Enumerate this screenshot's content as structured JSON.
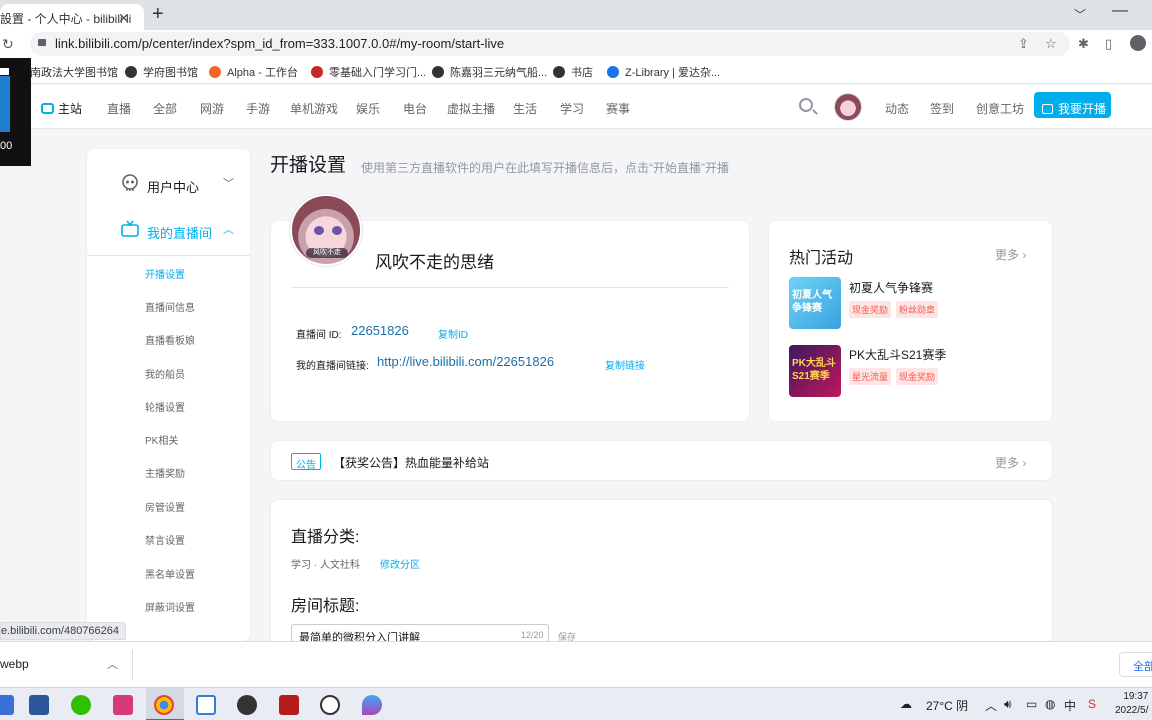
{
  "browser": {
    "tab_title": "設置 - 个人中心 - bilibili li",
    "tab_close": "✕",
    "new_tab": "+",
    "url": "link.bilibili.com/p/center/index?spm_id_from=333.1007.0.0#/my-room/start-live",
    "bookmarks": [
      {
        "label": "南政法大学图书馆",
        "color": "#1f5fa8"
      },
      {
        "label": "学府图书馆",
        "color": "#333333"
      },
      {
        "label": "Alpha - 工作台",
        "color": "#f26522"
      },
      {
        "label": "零基础入门学习门...",
        "color": "#c62828"
      },
      {
        "label": "陈嘉羽三元纳气船...",
        "color": "#333333"
      },
      {
        "label": "书店",
        "color": "#333333"
      },
      {
        "label": "Z-Library | 爱达杂...",
        "color": "#1a73e8"
      }
    ]
  },
  "overlay": {
    "text": "00"
  },
  "site_nav": {
    "items": [
      "主站",
      "直播",
      "全部",
      "网游",
      "手游",
      "单机游戏",
      "娱乐",
      "电台",
      "虚拟主播",
      "生活",
      "学习",
      "赛事"
    ],
    "right_links": [
      "动态",
      "签到",
      "创意工坊"
    ],
    "start_live": "我要开播"
  },
  "sidebar": {
    "groups": [
      {
        "label": "用户中心",
        "chevron": "﹀"
      },
      {
        "label": "我的直播间",
        "chevron": "︿"
      }
    ],
    "items": [
      "开播设置",
      "直播间信息",
      "直播看板娘",
      "我的船员",
      "轮播设置",
      "PK相关",
      "主播奖励",
      "房管设置",
      "禁言设置",
      "黑名单设置",
      "屏蔽词设置"
    ]
  },
  "page": {
    "title": "开播设置",
    "subtitle": "使用第三方直播软件的用户在此填写开播信息后，点击“开始直播”开播"
  },
  "profile": {
    "avatar_badge": "风吹不走",
    "username": "风吹不走的思绪",
    "room_id_label": "直播间 ID:",
    "room_id": "22651826",
    "copy_id": "复制ID",
    "link_label": "我的直播间链接:",
    "link": "http://live.bilibili.com/22651826",
    "copy_link": "复制链接"
  },
  "hot": {
    "title": "热门活动",
    "more": "更多 ›",
    "activities": [
      {
        "name": "初夏人气争锋赛",
        "thumb_text": "初夏人气争锋赛",
        "tags": [
          "现金奖励",
          "粉丝勋章"
        ]
      },
      {
        "name": "PK大乱斗S21赛季",
        "thumb_text": "PK大乱斗S21赛季",
        "tags": [
          "星光流量",
          "现金奖励"
        ]
      }
    ]
  },
  "notice": {
    "tag": "公告",
    "text": "【获奖公告】热血能量补给站",
    "more": "更多 ›"
  },
  "settings": {
    "category_title": "直播分类:",
    "category": "学习 · 人文社科",
    "change_category": "修改分区",
    "room_title_label": "房间标题:",
    "room_title": "最简单的微积分入门讲解",
    "title_count": "12/20",
    "save": "保存"
  },
  "status_link": "e.bilibili.com/480766264",
  "download": {
    "filename": "webp",
    "show_all": "全部"
  },
  "tray": {
    "weather": "27°C 阴",
    "ime": "中",
    "time": "19:37",
    "date": "2022/5/"
  }
}
